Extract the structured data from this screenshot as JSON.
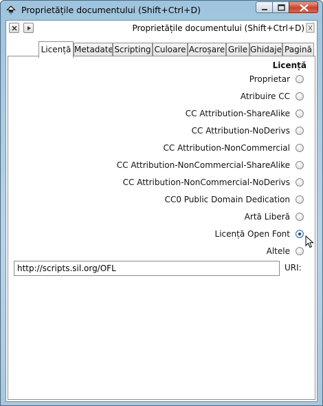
{
  "window": {
    "title": "Proprietățile documentului (Shift+Ctrl+D)"
  },
  "dock": {
    "title": "Proprietățile documentului (Shift+Ctrl+D)"
  },
  "tabs": [
    {
      "label": "Licență",
      "active": true
    },
    {
      "label": "Metadate",
      "active": false
    },
    {
      "label": "Scripting",
      "active": false
    },
    {
      "label": "Culoare",
      "active": false
    },
    {
      "label": "Acroșare",
      "active": false
    },
    {
      "label": "Grile",
      "active": false
    },
    {
      "label": "Ghidaje",
      "active": false
    },
    {
      "label": "Pagină",
      "active": false
    }
  ],
  "license": {
    "section_title": "Licență",
    "options": [
      {
        "label": "Proprietar",
        "selected": false
      },
      {
        "label": "Atribuire CC",
        "selected": false
      },
      {
        "label": "CC Attribution-ShareAlike",
        "selected": false
      },
      {
        "label": "CC Attribution-NoDerivs",
        "selected": false
      },
      {
        "label": "CC Attribution-NonCommercial",
        "selected": false
      },
      {
        "label": "CC Attribution-NonCommercial-ShareAlike",
        "selected": false
      },
      {
        "label": "CC Attribution-NonCommercial-NoDerivs",
        "selected": false
      },
      {
        "label": "CC0 Public Domain Dedication",
        "selected": false
      },
      {
        "label": "Artă Liberă",
        "selected": false
      },
      {
        "label": "Licență Open Font",
        "selected": true
      },
      {
        "label": "Altele",
        "selected": false
      }
    ],
    "uri_value": "http://scripts.sil.org/OFL",
    "uri_label": "URI:"
  },
  "icons": {
    "app": "inkscape-icon",
    "minimize": "minimize-icon",
    "maximize": "maximize-icon",
    "close": "close-icon",
    "dock_close": "close-icon",
    "dock_iconify": "iconify-icon",
    "dock_handle": "drag-handle-icon"
  },
  "colors": {
    "selected_radio": "#1b4a74",
    "close_button": "#c8452f"
  }
}
